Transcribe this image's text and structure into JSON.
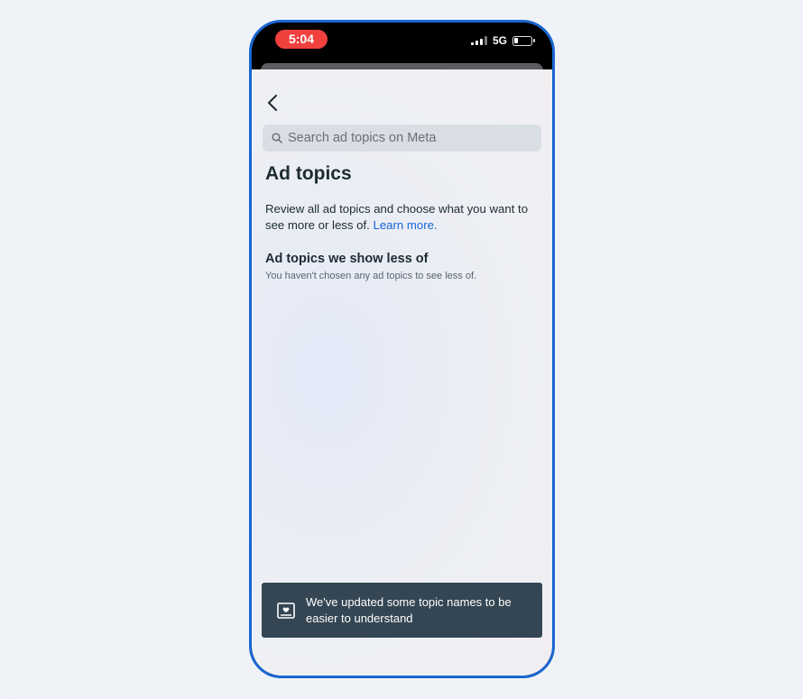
{
  "status_bar": {
    "time": "5:04",
    "network": "5G",
    "icons": [
      "signal-icon",
      "battery-icon"
    ]
  },
  "nav": {
    "back_icon": "chevron-left-icon"
  },
  "search": {
    "placeholder": "Search ad topics on Meta",
    "value": "",
    "icon": "search-icon"
  },
  "page": {
    "title": "Ad topics",
    "description": "Review all ad topics and choose what you want to see more or less of.",
    "learn_more": "Learn more."
  },
  "section": {
    "title": "Ad topics we show less of",
    "subtitle": "You haven't chosen any ad topics to see less of."
  },
  "toast": {
    "icon": "topic-card-icon",
    "text": "We've updated some topic names to be easier to understand"
  },
  "colors": {
    "frame": "#1a66d2",
    "time_pill": "#f0413f",
    "link": "#1565d8",
    "toast_bg": "#344653",
    "text": "#1c2b33"
  }
}
